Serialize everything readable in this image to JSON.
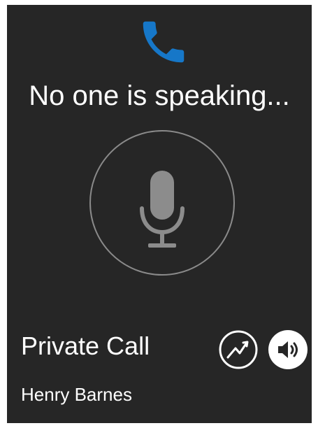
{
  "call": {
    "status_text": "No one is speaking...",
    "type_label": "Private Call",
    "contact_name": "Henry Barnes"
  },
  "icons": {
    "call": "phone-icon",
    "talk": "microphone-icon",
    "activity": "activity-icon",
    "audio": "speaker-icon"
  },
  "colors": {
    "background": "#262626",
    "accent_phone": "#1677c8",
    "text": "#ffffff",
    "ring": "#8a8a8a",
    "mic": "#8c8c8c"
  }
}
